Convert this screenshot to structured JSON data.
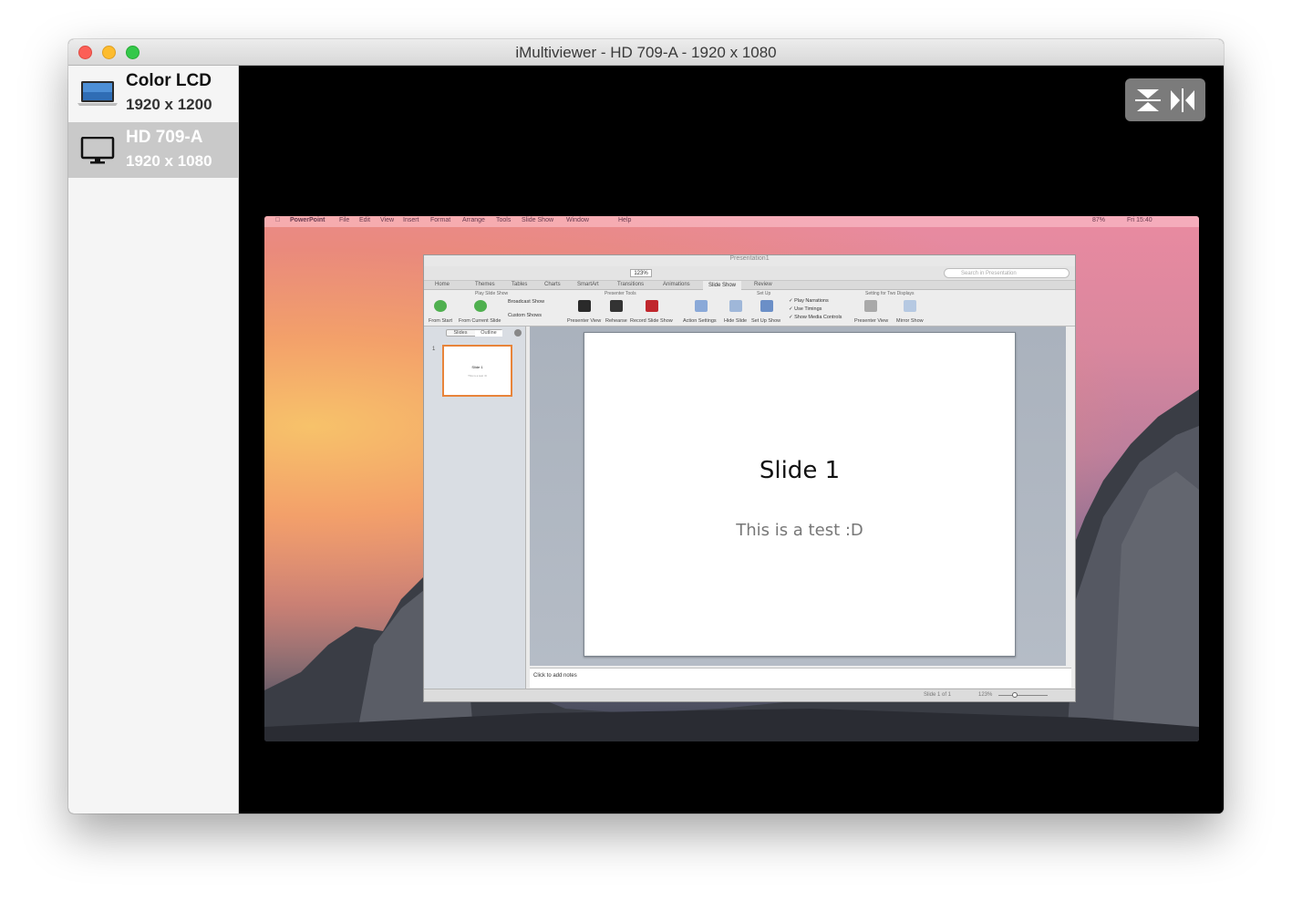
{
  "window": {
    "title": "iMultiviewer - HD 709-A - 1920 x 1080"
  },
  "sidebar": {
    "displays": [
      {
        "name": "Color LCD",
        "resolution": "1920 x 1200",
        "icon": "laptop-icon",
        "selected": false
      },
      {
        "name": "HD 709-A",
        "resolution": "1920 x 1080",
        "icon": "monitor-icon",
        "selected": true
      }
    ]
  },
  "toolbar": {
    "fit_icon": "fit-to-screen-icon",
    "mirror_icon": "mirror-icon"
  },
  "remote": {
    "menubar": {
      "app": "PowerPoint",
      "items": [
        "File",
        "Edit",
        "View",
        "Insert",
        "Format",
        "Arrange",
        "Tools",
        "Slide Show",
        "Window",
        "Help"
      ],
      "battery": "87%",
      "clock": "Fri 15:40"
    },
    "ppt": {
      "doc_title": "Presentation1",
      "search_placeholder": "Search in Presentation",
      "zoom_box": "123%",
      "tabs": [
        "Home",
        "Themes",
        "Tables",
        "Charts",
        "SmartArt",
        "Transitions",
        "Animations",
        "Slide Show",
        "Review"
      ],
      "active_tab": "Slide Show",
      "groups": {
        "play": "Play Slide Show",
        "presenter": "Presenter Tools",
        "setup": "Set Up",
        "two_displays": "Setting for Two Displays"
      },
      "buttons": {
        "from_start": "From Start",
        "from_current": "From Current Slide",
        "broadcast": "Broadcast Show",
        "custom_shows": "Custom Shows",
        "presenter_view": "Presenter View",
        "rehearse": "Rehearse",
        "record": "Record Slide Show",
        "action_settings": "Action Settings",
        "hide_slide": "Hide Slide",
        "set_up_show": "Set Up Show",
        "play_narrations": "Play Narrations",
        "use_timings": "Use Timings",
        "show_media_controls": "Show Media Controls",
        "presenter_view_2": "Presenter View",
        "mirror_show": "Mirror Show"
      },
      "pane_tabs": [
        "Slides",
        "Outline"
      ],
      "thumb": {
        "number": "1",
        "title": "Slide 1",
        "subtitle": "This is a test :D"
      },
      "slide": {
        "title": "Slide 1",
        "subtitle": "This is a test :D"
      },
      "notes_placeholder": "Click to add notes",
      "status": {
        "slide_count": "Slide 1 of 1",
        "zoom": "123%"
      }
    }
  }
}
